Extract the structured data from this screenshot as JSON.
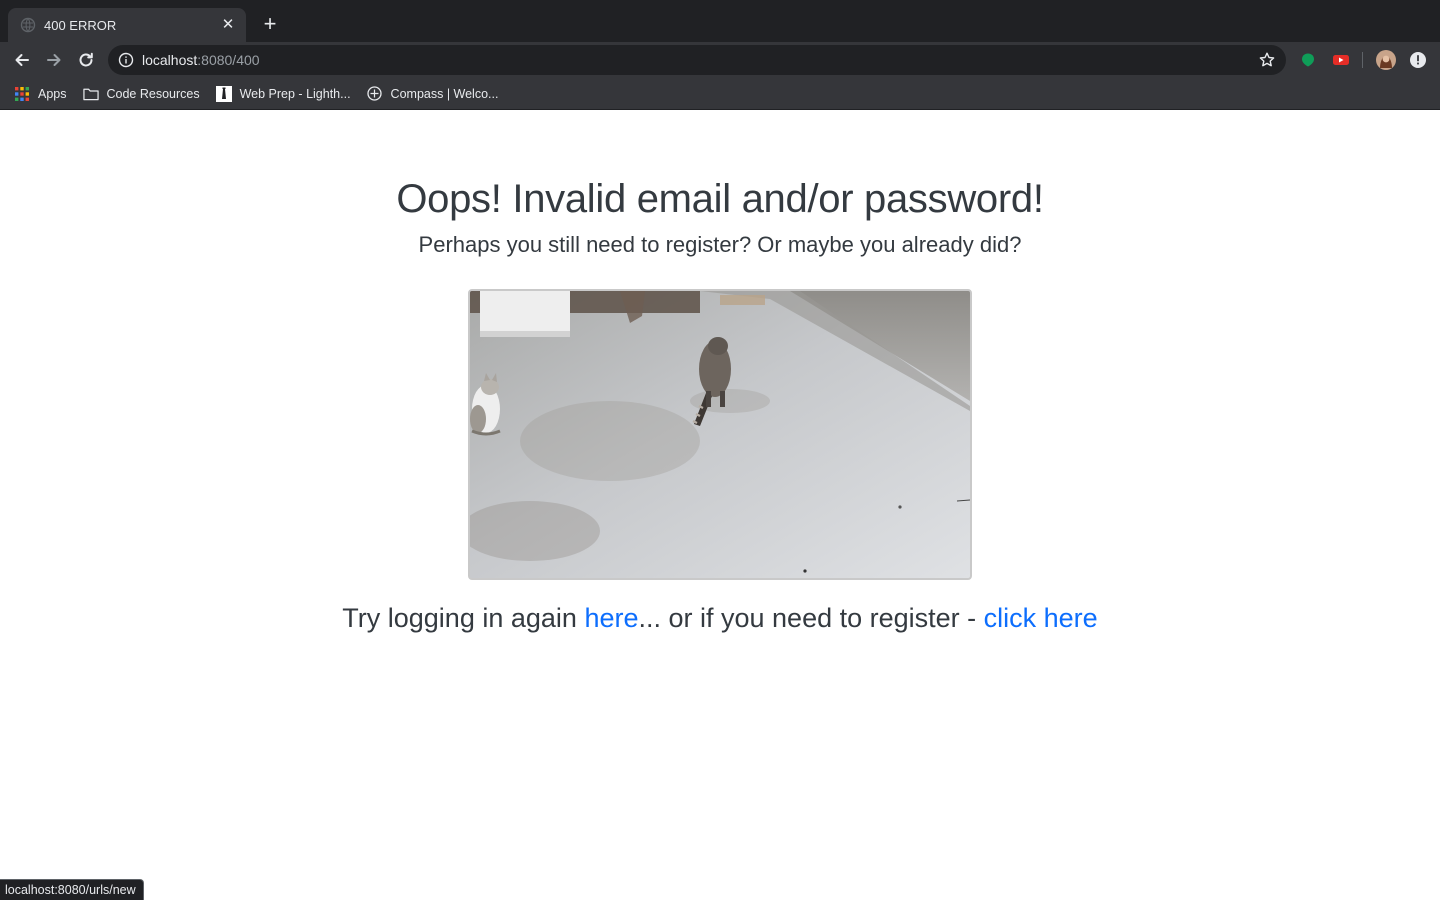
{
  "browser": {
    "tab": {
      "title": "400 ERROR"
    },
    "address": {
      "host": "localhost",
      "path": ":8080/400"
    },
    "bookmarks": [
      {
        "label": "Apps",
        "icon": "apps-grid-icon"
      },
      {
        "label": "Code Resources",
        "icon": "folder-icon"
      },
      {
        "label": "Web Prep - Lighth...",
        "icon": "lighthouse-labs-icon"
      },
      {
        "label": "Compass | Welco...",
        "icon": "compass-icon"
      }
    ],
    "status_url": "localhost:8080/urls/new"
  },
  "page": {
    "heading": "Oops! Invalid email and/or password!",
    "subheading": "Perhaps you still need to register? Or maybe you already did?",
    "footer": {
      "prefix": "Try logging in again ",
      "login_link": "here",
      "middle": "...  or if you need to register - ",
      "register_link": "click here"
    }
  },
  "colors": {
    "link": "#0d6efd",
    "text": "#343a40",
    "chrome_dark": "#202124",
    "chrome_toolbar": "#35363a"
  }
}
